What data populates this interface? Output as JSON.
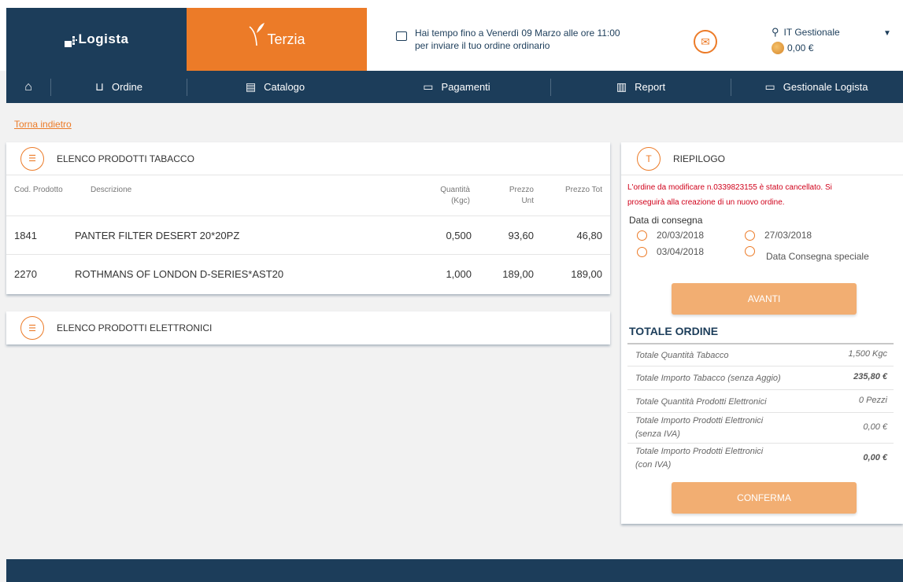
{
  "brand": {
    "logista": "Logista",
    "terzia": "Terzia"
  },
  "header": {
    "deadline_line1": "Hai tempo fino a Venerdì 09 Marzo alle ore 11:00",
    "deadline_line2": "per inviare il tuo ordine ordinario",
    "user_name": "IT Gestionale",
    "balance": "0,00 €"
  },
  "nav": {
    "ordine": "Ordine",
    "catalogo": "Catalogo",
    "pagamenti": "Pagamenti",
    "report": "Report",
    "gestionale": "Gestionale Logista"
  },
  "back_link": "Torna indietro",
  "tabacco": {
    "title": "ELENCO PRODOTTI TABACCO",
    "columns": {
      "code": "Cod. Prodotto",
      "desc": "Descrizione",
      "qty_1": "Quantità",
      "qty_2": "(Kgc)",
      "price_1": "Prezzo",
      "price_2": "Unt",
      "total": "Prezzo Tot"
    },
    "rows": [
      {
        "code": "1841",
        "desc": "PANTER FILTER DESERT 20*20PZ",
        "qty": "0,500",
        "price": "93,60",
        "total": "46,80"
      },
      {
        "code": "2270",
        "desc": "ROTHMANS OF LONDON D-SERIES*AST20",
        "qty": "1,000",
        "price": "189,00",
        "total": "189,00"
      }
    ]
  },
  "elettronici": {
    "title": "ELENCO PRODOTTI ELETTRONICI"
  },
  "riepilogo": {
    "icon_letter": "T",
    "title": "RIEPILOGO",
    "notice_1": "L'ordine da modificare n.0339823155 è stato cancellato. Si",
    "notice_2": "proseguirà alla creazione di un nuovo ordine.",
    "delivery_label": "Data di consegna",
    "dates": [
      "20/03/2018",
      "27/03/2018",
      "03/04/2018",
      "Data Consegna speciale"
    ],
    "avanti": "AVANTI",
    "totale_title": "TOTALE ORDINE",
    "totals": [
      {
        "label_1": "Totale Quantità Tabacco",
        "label_2": "",
        "value": "1,500 Kgc"
      },
      {
        "label_1": "Totale Importo Tabacco (senza Aggio)",
        "label_2": "",
        "value": "235,80 €"
      },
      {
        "label_1": "Totale Quantità Prodotti Elettronici",
        "label_2": "",
        "value": "0 Pezzi"
      },
      {
        "label_1": "Totale Importo Prodotti Elettronici",
        "label_2": "(senza IVA)",
        "value": "0,00 €"
      },
      {
        "label_1": "Totale Importo Prodotti Elettronici",
        "label_2": "(con IVA)",
        "value": "0,00 €"
      }
    ],
    "conferma": "CONFERMA"
  },
  "colors": {
    "navy": "#1c3d5a",
    "orange": "#ec7b28",
    "button": "#f2ae72",
    "error": "#d0021b"
  }
}
